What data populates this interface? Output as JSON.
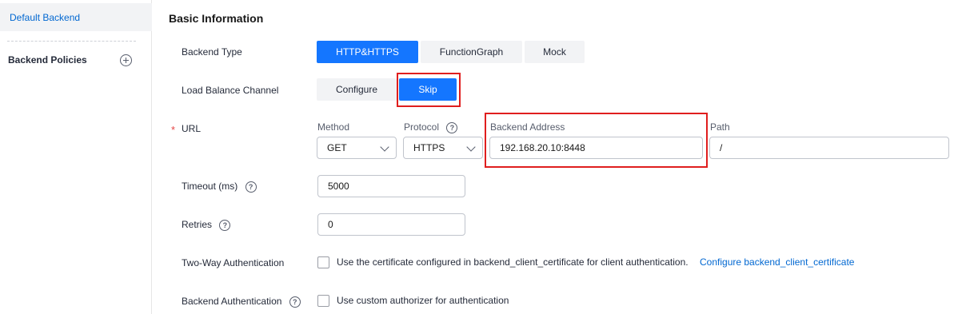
{
  "sidebar": {
    "default_backend": "Default Backend",
    "backend_policies": "Backend Policies"
  },
  "section": {
    "title": "Basic Information"
  },
  "backend_type": {
    "label": "Backend Type",
    "options": [
      "HTTP&HTTPS",
      "FunctionGraph",
      "Mock"
    ],
    "selected": "HTTP&HTTPS"
  },
  "load_balance": {
    "label": "Load Balance Channel",
    "options": [
      "Configure",
      "Skip"
    ],
    "selected": "Skip"
  },
  "url": {
    "required_mark": "*",
    "label": "URL",
    "method_label": "Method",
    "method_value": "GET",
    "protocol_label": "Protocol",
    "protocol_value": "HTTPS",
    "address_label": "Backend Address",
    "address_value": "192.168.20.10:8448",
    "path_label": "Path",
    "path_value": "/"
  },
  "timeout": {
    "label": "Timeout (ms)",
    "value": "5000"
  },
  "retries": {
    "label": "Retries",
    "value": "0"
  },
  "two_way": {
    "label": "Two-Way Authentication",
    "checkbox_text": "Use the certificate configured in backend_client_certificate for client authentication.",
    "link": "Configure backend_client_certificate",
    "checked": false
  },
  "backend_auth": {
    "label": "Backend Authentication",
    "checkbox_text": "Use custom authorizer for authentication",
    "checked": false
  },
  "help_glyph": "?",
  "colors": {
    "primary": "#1476ff",
    "link": "#0067d1",
    "highlight": "#e01e1e",
    "required": "#e54545"
  }
}
